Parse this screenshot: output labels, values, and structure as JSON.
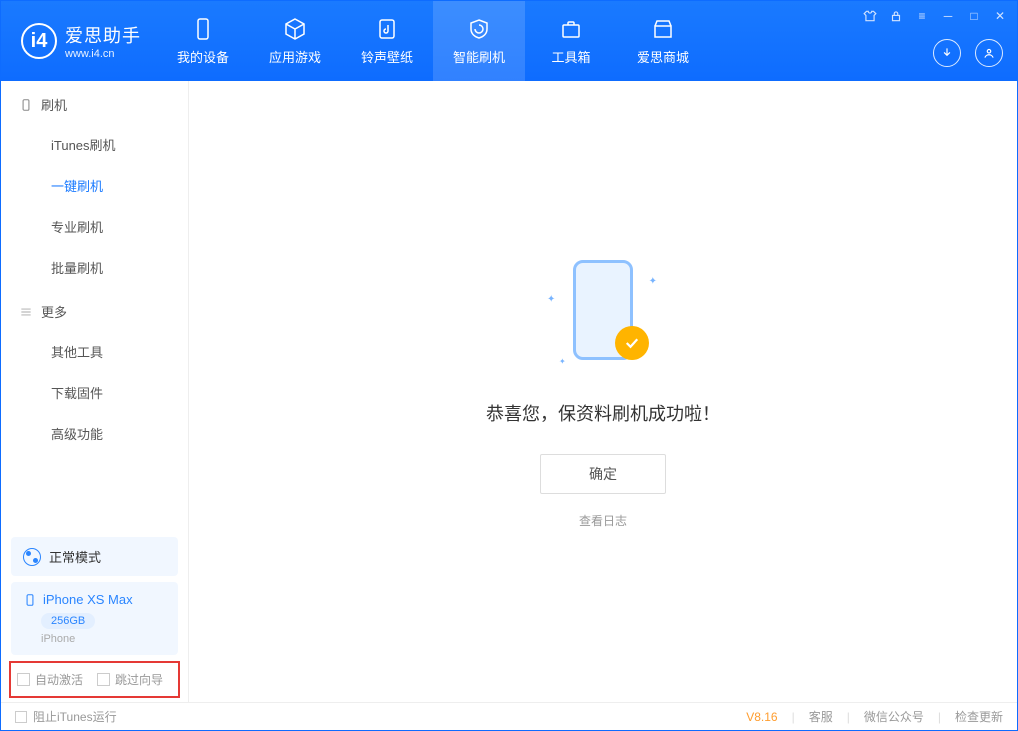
{
  "app": {
    "title": "爱思助手",
    "url": "www.i4.cn"
  },
  "header_tabs": [
    {
      "label": "我的设备"
    },
    {
      "label": "应用游戏"
    },
    {
      "label": "铃声壁纸"
    },
    {
      "label": "智能刷机"
    },
    {
      "label": "工具箱"
    },
    {
      "label": "爱思商城"
    }
  ],
  "sidebar": {
    "section1_title": "刷机",
    "items1": [
      {
        "label": "iTunes刷机"
      },
      {
        "label": "一键刷机"
      },
      {
        "label": "专业刷机"
      },
      {
        "label": "批量刷机"
      }
    ],
    "section2_title": "更多",
    "items2": [
      {
        "label": "其他工具"
      },
      {
        "label": "下载固件"
      },
      {
        "label": "高级功能"
      }
    ],
    "mode_label": "正常模式",
    "device_name": "iPhone XS Max",
    "device_storage": "256GB",
    "device_type": "iPhone",
    "checkbox_auto_activate": "自动激活",
    "checkbox_skip_guide": "跳过向导"
  },
  "main": {
    "success_msg": "恭喜您，保资料刷机成功啦！",
    "ok_button": "确定",
    "log_link": "查看日志"
  },
  "statusbar": {
    "block_itunes": "阻止iTunes运行",
    "version": "V8.16",
    "link_cs": "客服",
    "link_wechat": "微信公众号",
    "link_update": "检查更新"
  }
}
